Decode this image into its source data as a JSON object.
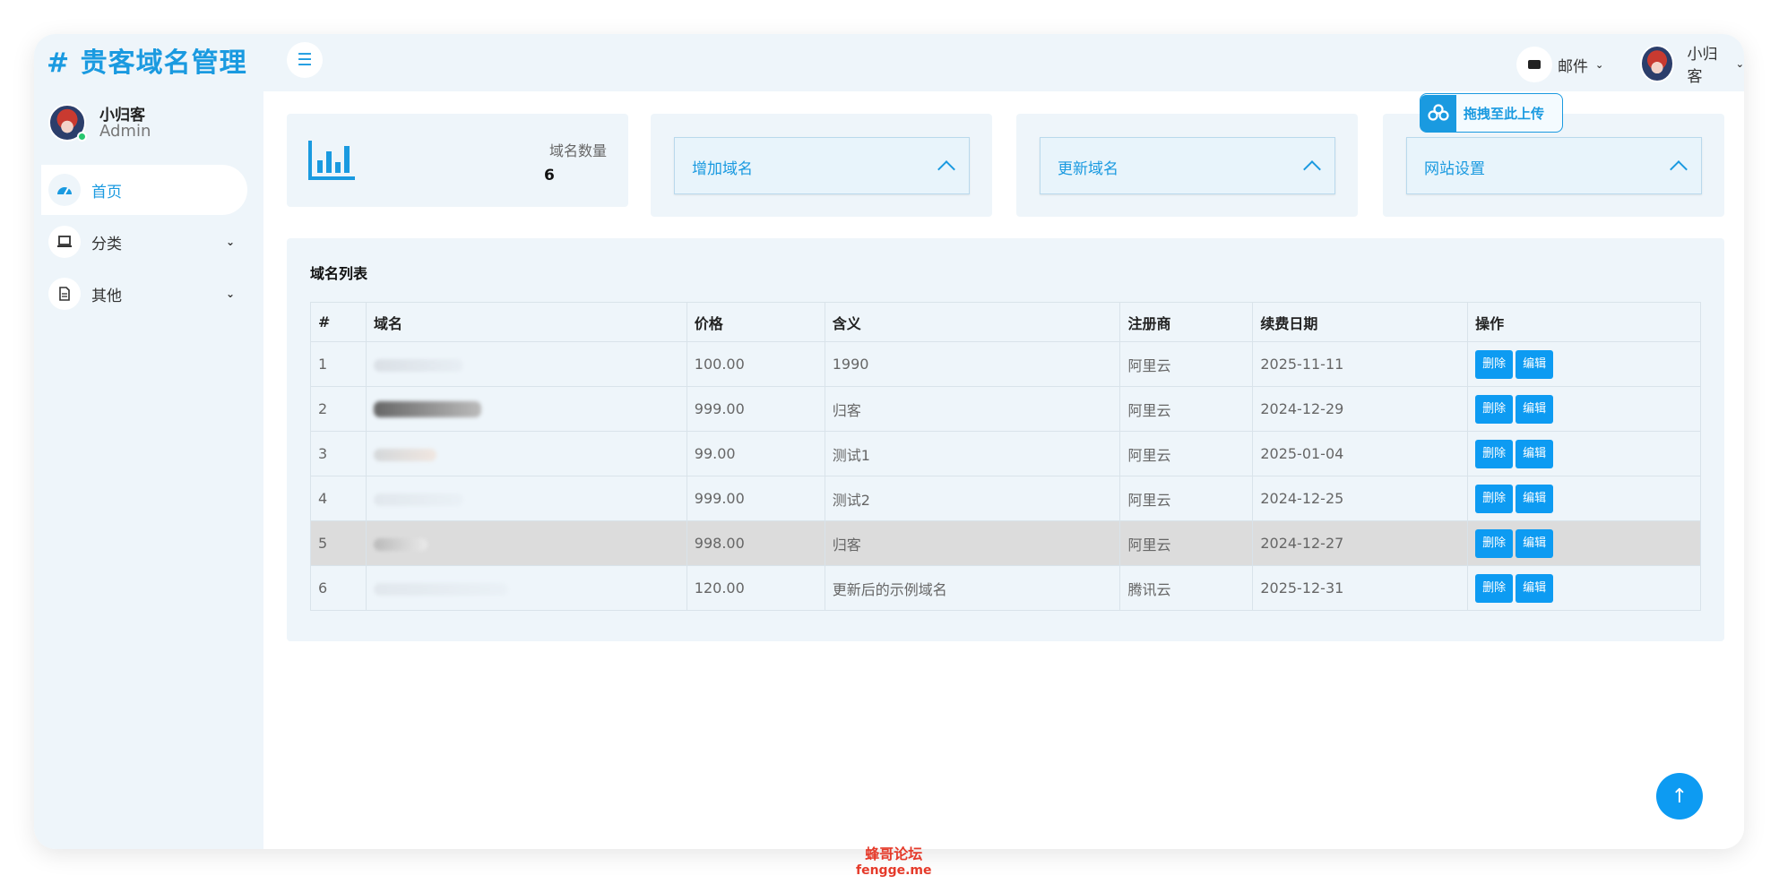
{
  "brand": {
    "title": "# 贵客域名管理"
  },
  "profile": {
    "name": "小归客",
    "role": "Admin"
  },
  "nav": {
    "items": [
      {
        "label": "首页",
        "icon": "dashboard-icon",
        "active": true
      },
      {
        "label": "分类",
        "icon": "laptop-icon",
        "has_submenu": true
      },
      {
        "label": "其他",
        "icon": "document-icon",
        "has_submenu": true
      }
    ]
  },
  "header": {
    "mail_label": "邮件",
    "user_name": "小归客",
    "upload_label": "拖拽至此上传"
  },
  "stats": {
    "label": "域名数量",
    "value": "6"
  },
  "accordions": [
    {
      "label": "增加域名"
    },
    {
      "label": "更新域名"
    },
    {
      "label": "网站设置"
    }
  ],
  "list": {
    "title": "域名列表",
    "columns": [
      "#",
      "域名",
      "价格",
      "含义",
      "注册商",
      "续费日期",
      "操作"
    ],
    "rows": [
      {
        "id": "1",
        "price": "100.00",
        "meaning": "1990",
        "registrar": "阿里云",
        "renew_date": "2025-11-11"
      },
      {
        "id": "2",
        "price": "999.00",
        "meaning": "归客",
        "registrar": "阿里云",
        "renew_date": "2024-12-29"
      },
      {
        "id": "3",
        "price": "99.00",
        "meaning": "测试1",
        "registrar": "阿里云",
        "renew_date": "2025-01-04"
      },
      {
        "id": "4",
        "price": "999.00",
        "meaning": "测试2",
        "registrar": "阿里云",
        "renew_date": "2024-12-25"
      },
      {
        "id": "5",
        "price": "998.00",
        "meaning": "归客",
        "registrar": "阿里云",
        "renew_date": "2024-12-27"
      },
      {
        "id": "6",
        "price": "120.00",
        "meaning": "更新后的示例域名",
        "registrar": "腾讯云",
        "renew_date": "2025-12-31"
      }
    ],
    "delete_label": "删除",
    "edit_label": "编辑"
  },
  "watermark": {
    "line1": "蜂哥论坛",
    "line2": "fengge.me"
  },
  "colors": {
    "accent": "#1a9ae0",
    "button": "#0d9bf2",
    "panel": "#eef5fa"
  }
}
